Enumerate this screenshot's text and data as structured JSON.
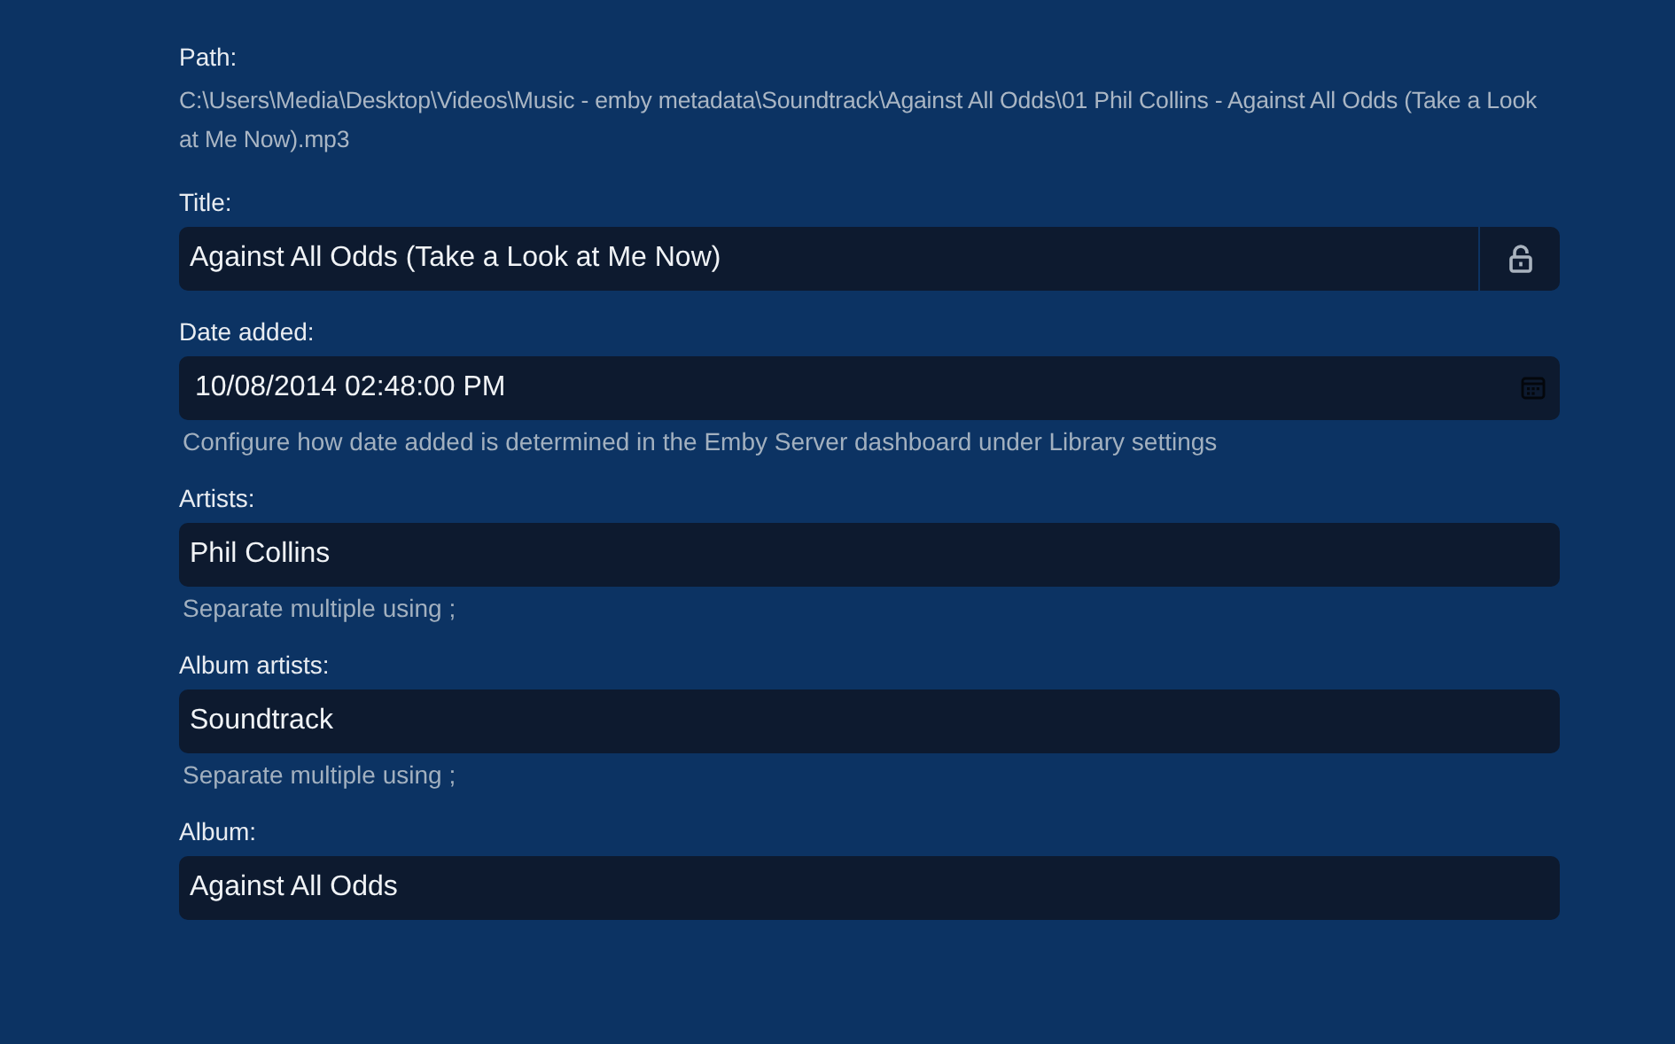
{
  "path": {
    "label": "Path:",
    "value": "C:\\Users\\Media\\Desktop\\Videos\\Music - emby metadata\\Soundtrack\\Against All Odds\\01 Phil Collins - Against All Odds (Take a Look at Me Now).mp3"
  },
  "fields": [
    {
      "kind": "lock",
      "label": "Title:",
      "value": "Against All Odds (Take a Look at Me Now)",
      "locked": false
    },
    {
      "kind": "date",
      "label": "Date added:",
      "value": "10/08/2014 02:48:00 PM",
      "hint": "Configure how date added is determined in the Emby Server dashboard under Library settings"
    },
    {
      "kind": "text",
      "label": "Artists:",
      "value": "Phil Collins",
      "hint": "Separate multiple using ;"
    },
    {
      "kind": "text",
      "label": "Album artists:",
      "value": "Soundtrack",
      "hint": "Separate multiple using ;"
    },
    {
      "kind": "text",
      "label": "Album:",
      "value": "Against All Odds"
    }
  ]
}
